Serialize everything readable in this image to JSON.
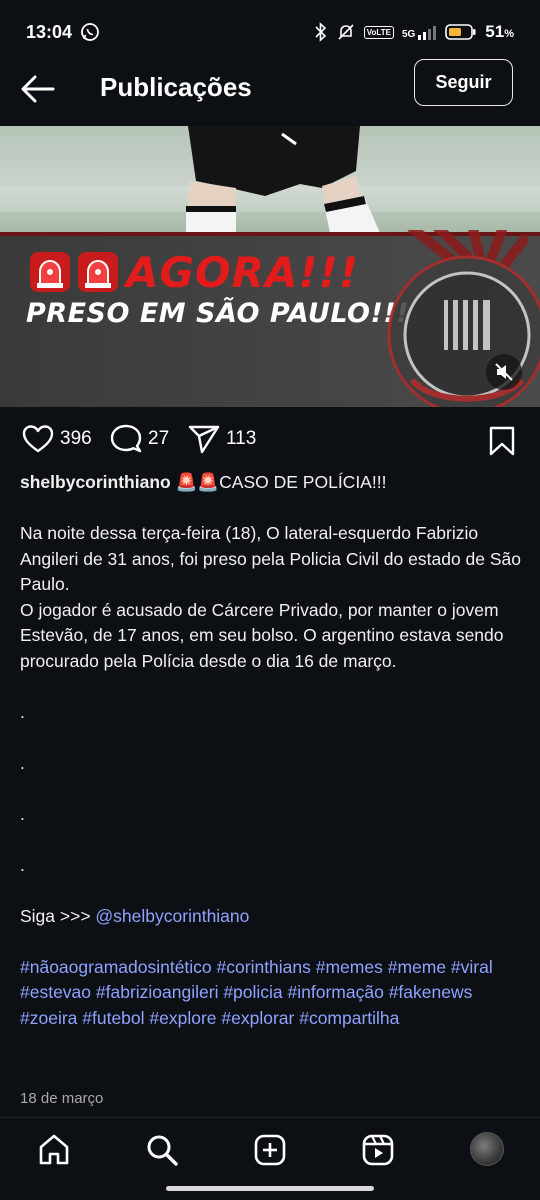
{
  "status_bar": {
    "time": "13:04",
    "battery_pct": "51",
    "battery_unit": "%",
    "network": "5G",
    "volte": "VoLTE"
  },
  "header": {
    "title": "Publicações",
    "follow_label": "Seguir"
  },
  "post": {
    "banner_line1": "AGORA!!!",
    "banner_line2": "PRESO EM SÃO PAULO!!!",
    "likes": "396",
    "comments": "27",
    "shares": "113",
    "username": "shelbycorinthiano",
    "caption_title": "🚨🚨CASO DE POLÍCIA!!!",
    "paragraph_1": "Na noite dessa terça-feira (18), O lateral-esquerdo Fabrizio Angileri de 31 anos, foi preso pela Policia Civil do estado de São Paulo.",
    "paragraph_2": "O jogador é acusado de Cárcere Privado, por manter o jovem Estevão, de 17 anos, em seu bolso. O argentino estava sendo procurado pela Polícia desde o dia 16 de março.",
    "dots": [
      ".",
      ".",
      ".",
      "."
    ],
    "siga_prefix": "Siga >>> ",
    "siga_handle": "@shelbycorinthiano",
    "hashtags": "#nãoaogramadosintético #corinthians #memes #meme #viral #estevao #fabrizioangileri #policia #informação #fakenews #zoeira #futebol #explore #explorar #compartilha",
    "date": "18 de março"
  },
  "colors": {
    "background": "#0c1014",
    "link": "#8fa2ff",
    "headline_red": "#e21b1b"
  },
  "icons": {
    "back": "arrow-left-icon",
    "like": "heart-icon",
    "comment": "comment-icon",
    "share": "send-icon",
    "save": "bookmark-icon",
    "mute": "speaker-muted-icon",
    "home": "home-icon",
    "search": "search-icon",
    "create": "plus-square-icon",
    "reels": "reels-icon"
  }
}
